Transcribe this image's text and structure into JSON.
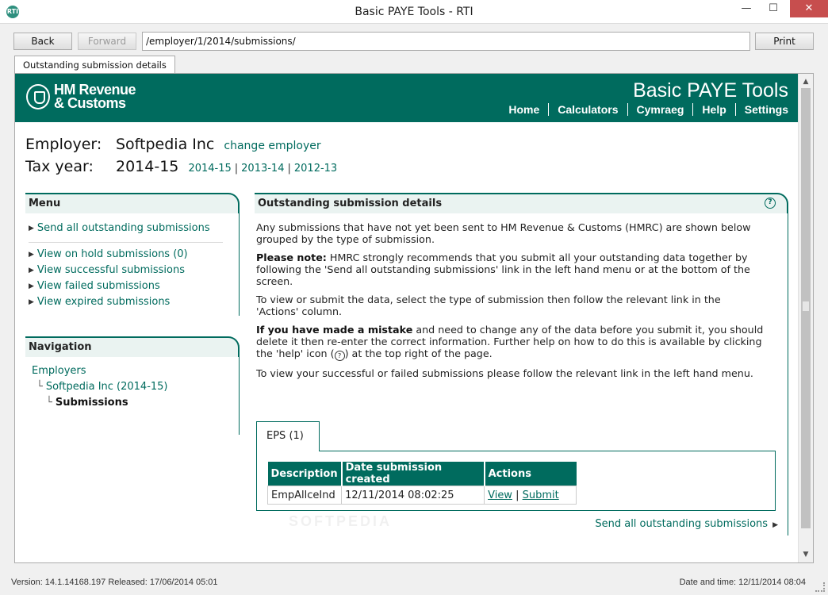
{
  "window": {
    "title": "Basic PAYE Tools - RTI",
    "app_icon": "hmrc-app-icon",
    "minimize": "—",
    "maximize": "☐",
    "close": "✕"
  },
  "toolbar": {
    "back_label": "Back",
    "forward_label": "Forward",
    "address": "/employer/1/2014/submissions/",
    "print_label": "Print"
  },
  "tab": {
    "label": "Outstanding submission details"
  },
  "banner": {
    "logo_line1": "HM Revenue",
    "logo_line2": "& Customs",
    "title": "Basic PAYE Tools",
    "nav": [
      "Home",
      "Calculators",
      "Cymraeg",
      "Help",
      "Settings"
    ]
  },
  "employer": {
    "label": "Employer:",
    "name": "Softpedia Inc",
    "change_link": "change employer",
    "tax_year_label": "Tax year:",
    "tax_year": "2014-15",
    "year_links": [
      "2014-15",
      "2013-14",
      "2012-13"
    ]
  },
  "menu": {
    "title": "Menu",
    "primary": "Send all outstanding submissions",
    "items": [
      "View on hold submissions (0)",
      "View successful submissions",
      "View failed submissions",
      "View expired submissions"
    ]
  },
  "navigation": {
    "title": "Navigation",
    "level1": "Employers",
    "level2": "Softpedia Inc (2014-15)",
    "level3": "Submissions"
  },
  "main": {
    "title": "Outstanding submission details",
    "p1": "Any submissions that have not yet been sent to HM Revenue & Customs (HMRC) are shown below grouped by the type of submission.",
    "p2_bold": "Please note:",
    "p2_rest": " HMRC strongly recommends that you submit all your outstanding data together by following the 'Send all outstanding submissions' link in the left hand menu or at the bottom of the screen.",
    "p3": "To view or submit the data, select the type of submission then follow the relevant link in the 'Actions' column.",
    "p4_bold": "If you have made a mistake",
    "p4_rest1": " and need to change any of the data before you submit it, you should delete it then re-enter the correct information. Further help on how to do this is available by clicking the 'help' icon (",
    "p4_rest2": ") at the top right of the page.",
    "p5": "To view your successful or failed submissions please follow the relevant link in the left hand menu.",
    "eps_tab": "EPS (1)",
    "table": {
      "headers": [
        "Description",
        "Date submission created",
        "Actions"
      ],
      "rows": [
        {
          "description": "EmpAllceInd",
          "date": "12/11/2014 08:02:25",
          "view": "View",
          "submit": "Submit"
        }
      ]
    },
    "send_all_link": "Send all outstanding submissions"
  },
  "watermark": "SOFTPEDIA",
  "status": {
    "left": "Version: 14.1.14168.197 Released: 17/06/2014 05:01",
    "right": "Date and time: 12/11/2014 08:04"
  }
}
